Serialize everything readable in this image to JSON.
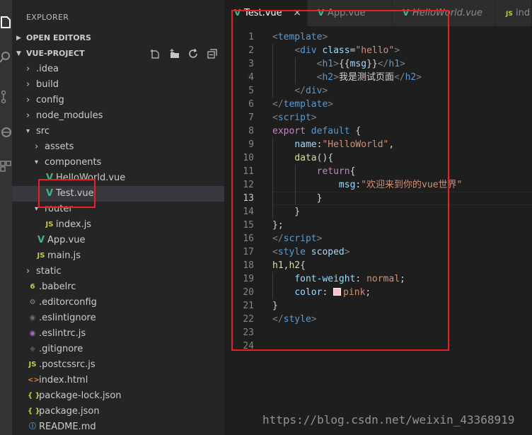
{
  "sidebar": {
    "title": "EXPLORER",
    "open_editors": "OPEN EDITORS",
    "project": "VUE-PROJECT",
    "actions": [
      "new-file-icon",
      "new-folder-icon",
      "refresh-icon",
      "collapse-all-icon"
    ],
    "tree": [
      {
        "label": ".idea",
        "type": "folder",
        "depth": 0,
        "expanded": false,
        "icon": ""
      },
      {
        "label": "build",
        "type": "folder",
        "depth": 0,
        "expanded": false,
        "icon": ""
      },
      {
        "label": "config",
        "type": "folder",
        "depth": 0,
        "expanded": false,
        "icon": ""
      },
      {
        "label": "node_modules",
        "type": "folder",
        "depth": 0,
        "expanded": false,
        "icon": ""
      },
      {
        "label": "src",
        "type": "folder",
        "depth": 0,
        "expanded": true,
        "icon": ""
      },
      {
        "label": "assets",
        "type": "folder",
        "depth": 1,
        "expanded": false,
        "icon": ""
      },
      {
        "label": "components",
        "type": "folder",
        "depth": 1,
        "expanded": true,
        "icon": ""
      },
      {
        "label": "HelloWorld.vue",
        "type": "file",
        "depth": 2,
        "icon": "vue"
      },
      {
        "label": "Test.vue",
        "type": "file",
        "depth": 2,
        "icon": "vue",
        "selected": true
      },
      {
        "label": "router",
        "type": "folder",
        "depth": 1,
        "expanded": true,
        "icon": ""
      },
      {
        "label": "index.js",
        "type": "file",
        "depth": 2,
        "icon": "js"
      },
      {
        "label": "App.vue",
        "type": "file",
        "depth": 1,
        "icon": "vue"
      },
      {
        "label": "main.js",
        "type": "file",
        "depth": 1,
        "icon": "js"
      },
      {
        "label": "static",
        "type": "folder",
        "depth": 0,
        "expanded": false,
        "icon": ""
      },
      {
        "label": ".babelrc",
        "type": "file",
        "depth": 0,
        "icon": "babel"
      },
      {
        "label": ".editorconfig",
        "type": "file",
        "depth": 0,
        "icon": "gear"
      },
      {
        "label": ".eslintignore",
        "type": "file",
        "depth": 0,
        "icon": "eslint-ignore"
      },
      {
        "label": ".eslintrc.js",
        "type": "file",
        "depth": 0,
        "icon": "eslint"
      },
      {
        "label": ".gitignore",
        "type": "file",
        "depth": 0,
        "icon": "git"
      },
      {
        "label": ".postcssrc.js",
        "type": "file",
        "depth": 0,
        "icon": "js"
      },
      {
        "label": "index.html",
        "type": "file",
        "depth": 0,
        "icon": "html"
      },
      {
        "label": "package-lock.json",
        "type": "file",
        "depth": 0,
        "icon": "json"
      },
      {
        "label": "package.json",
        "type": "file",
        "depth": 0,
        "icon": "json"
      },
      {
        "label": "README.md",
        "type": "file",
        "depth": 0,
        "icon": "info"
      }
    ]
  },
  "tabs": [
    {
      "label": "Test.vue",
      "icon": "vue",
      "active": true,
      "italic": false,
      "close": "×"
    },
    {
      "label": "App.vue",
      "icon": "vue",
      "active": false,
      "italic": false
    },
    {
      "label": "HelloWorld.vue",
      "icon": "vue",
      "active": false,
      "italic": true
    },
    {
      "label": "ind",
      "icon": "js",
      "active": false,
      "italic": false
    }
  ],
  "editor": {
    "current_line": 13,
    "lines": [
      [
        [
          "tk-br",
          "<"
        ],
        [
          "tk-tag",
          "template"
        ],
        [
          "tk-br",
          ">"
        ]
      ],
      [
        [
          "tk-txt",
          "    "
        ],
        [
          "tk-br",
          "<"
        ],
        [
          "tk-tag",
          "div "
        ],
        [
          "tk-attr",
          "class"
        ],
        [
          "tk-txt",
          "="
        ],
        [
          "tk-str",
          "\"hello\""
        ],
        [
          "tk-br",
          ">"
        ]
      ],
      [
        [
          "tk-txt",
          "        "
        ],
        [
          "tk-br",
          "<"
        ],
        [
          "tk-tag",
          "h1"
        ],
        [
          "tk-br",
          ">"
        ],
        [
          "tk-txt",
          "{{"
        ],
        [
          "tk-attr",
          "msg"
        ],
        [
          "tk-txt",
          "}}"
        ],
        [
          "tk-br",
          "</"
        ],
        [
          "tk-tag",
          "h1"
        ],
        [
          "tk-br",
          ">"
        ]
      ],
      [
        [
          "tk-txt",
          "        "
        ],
        [
          "tk-br",
          "<"
        ],
        [
          "tk-tag",
          "h2"
        ],
        [
          "tk-br",
          ">"
        ],
        [
          "tk-txt",
          "我是测试页面"
        ],
        [
          "tk-br",
          "</"
        ],
        [
          "tk-tag",
          "h2"
        ],
        [
          "tk-br",
          ">"
        ]
      ],
      [
        [
          "tk-txt",
          "    "
        ],
        [
          "tk-br",
          "</"
        ],
        [
          "tk-tag",
          "div"
        ],
        [
          "tk-br",
          ">"
        ]
      ],
      [
        [
          "tk-br",
          "</"
        ],
        [
          "tk-tag",
          "template"
        ],
        [
          "tk-br",
          ">"
        ]
      ],
      [
        [
          "tk-br",
          "<"
        ],
        [
          "tk-tag",
          "script"
        ],
        [
          "tk-br",
          ">"
        ]
      ],
      [
        [
          "tk-ctl",
          "export "
        ],
        [
          "tk-key",
          "default "
        ],
        [
          "tk-txt",
          "{"
        ]
      ],
      [
        [
          "tk-txt",
          "    "
        ],
        [
          "tk-prop",
          "name"
        ],
        [
          "tk-txt",
          ":"
        ],
        [
          "tk-str",
          "\"HelloWorld\""
        ],
        [
          "tk-txt",
          ","
        ]
      ],
      [
        [
          "tk-txt",
          "    "
        ],
        [
          "tk-fn",
          "data"
        ],
        [
          "tk-txt",
          "(){"
        ]
      ],
      [
        [
          "tk-txt",
          "        "
        ],
        [
          "tk-ctl",
          "return"
        ],
        [
          "tk-txt",
          "{"
        ]
      ],
      [
        [
          "tk-txt",
          "            "
        ],
        [
          "tk-prop",
          "msg"
        ],
        [
          "tk-txt",
          ":"
        ],
        [
          "tk-str",
          "\"欢迎来到你的vue世界\""
        ]
      ],
      [
        [
          "tk-txt",
          "        }"
        ]
      ],
      [
        [
          "tk-txt",
          "    }"
        ]
      ],
      [
        [
          "tk-txt",
          "};"
        ]
      ],
      [
        [
          "tk-br",
          "</"
        ],
        [
          "tk-tag",
          "script"
        ],
        [
          "tk-br",
          ">"
        ]
      ],
      [
        [
          "tk-br",
          "<"
        ],
        [
          "tk-tag",
          "style "
        ],
        [
          "tk-attr",
          "scoped"
        ],
        [
          "tk-br",
          ">"
        ]
      ],
      [
        [
          "tk-fn",
          "h1"
        ],
        [
          "tk-txt",
          ","
        ],
        [
          "tk-fn",
          "h2"
        ],
        [
          "tk-txt",
          "{"
        ]
      ],
      [
        [
          "tk-txt",
          "    "
        ],
        [
          "tk-prop",
          "font-weight"
        ],
        [
          "tk-txt",
          ": "
        ],
        [
          "tk-str",
          "normal"
        ],
        [
          "tk-txt",
          ";"
        ]
      ],
      [
        [
          "tk-txt",
          "    "
        ],
        [
          "tk-prop",
          "color"
        ],
        [
          "tk-txt",
          ": "
        ],
        [
          "swatch",
          ""
        ],
        [
          "tk-str",
          "pink"
        ],
        [
          "tk-txt",
          ";"
        ]
      ],
      [
        [
          "tk-txt",
          "}"
        ]
      ],
      [
        [
          "tk-br",
          "</"
        ],
        [
          "tk-tag",
          "style"
        ],
        [
          "tk-br",
          ">"
        ]
      ],
      [],
      []
    ]
  },
  "watermark": "https://blog.csdn.net/weixin_43368919",
  "colors": {
    "annotation": "#e8202a",
    "vue": "#41b883",
    "js": "#cbcb41",
    "json": "#cbcb41",
    "html": "#e37933"
  }
}
